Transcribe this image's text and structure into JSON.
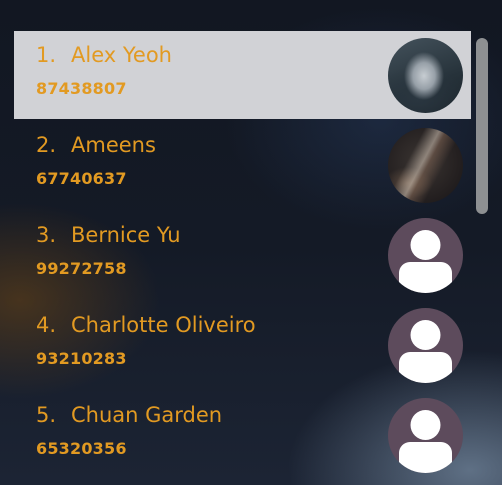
{
  "contacts": [
    {
      "index": "1.",
      "name": "Alex Yeoh",
      "phone": "87438807",
      "avatar": "wolf-photo",
      "selected": true
    },
    {
      "index": "2.",
      "name": "Ameens",
      "phone": "67740637",
      "avatar": "galaxy-photo",
      "selected": false
    },
    {
      "index": "3.",
      "name": "Bernice Yu",
      "phone": "99272758",
      "avatar": "default-person-icon",
      "selected": false
    },
    {
      "index": "4.",
      "name": "Charlotte Oliveiro",
      "phone": "93210283",
      "avatar": "default-person-icon",
      "selected": false
    },
    {
      "index": "5.",
      "name": "Chuan Garden",
      "phone": "65320356",
      "avatar": "default-person-icon",
      "selected": false
    }
  ],
  "colors": {
    "text_accent": "#e29a22",
    "selected_bg": "#d1d2d6",
    "avatar_default_bg": "#5d4b5c",
    "scrollbar": "#8e9092"
  }
}
